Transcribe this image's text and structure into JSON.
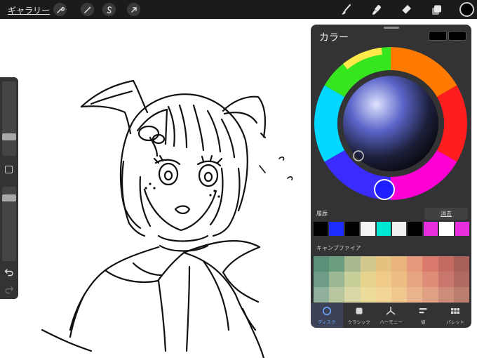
{
  "toolbar": {
    "gallery_label": "ギャラリー",
    "actions_icon": "wrench-icon",
    "adjustments_icon": "magic-wand-icon",
    "selection_icon": "s-curve-icon",
    "transform_icon": "arrow-icon",
    "tools": [
      "brush-icon",
      "smudge-icon",
      "eraser-icon",
      "layers-icon"
    ],
    "current_color": "#000000"
  },
  "color_panel": {
    "title": "カラー",
    "history_label": "履歴",
    "clear_label": "消去",
    "history_colors": [
      "#000000",
      "#1f2cff",
      "#000000",
      "#f4f6f6",
      "#00e8d4",
      "#f0f2f2",
      "#000000",
      "#e82fe0",
      "#ffffff",
      "#e82fe0"
    ],
    "palette_label": "キャンプファイア",
    "palette_colors": [
      [
        "#5b8f78",
        "#6b9e7f",
        "#a9b98e",
        "#d2c88e",
        "#e6c27f",
        "#e9b57c",
        "#e3997a",
        "#d97a6d",
        "#c56c62",
        "#a9605a"
      ],
      [
        "#6e9c86",
        "#9bb793",
        "#c9cf98",
        "#e6d48e",
        "#efcb87",
        "#eebd84",
        "#e7a681",
        "#dd8d78",
        "#c9776c",
        "#b06a62"
      ],
      [
        "#90b09b",
        "#b8c69f",
        "#d9d7a5",
        "#ecdc9c",
        "#f2d597",
        "#f0c78f",
        "#e9b38b",
        "#e0a084",
        "#cd8c7a",
        "#ba7d6f"
      ]
    ],
    "tabs": [
      {
        "label": "ディスク",
        "icon": "disc-icon",
        "active": true
      },
      {
        "label": "クラシック",
        "icon": "square-icon",
        "active": false
      },
      {
        "label": "ハーモニー",
        "icon": "harmony-icon",
        "active": false
      },
      {
        "label": "値",
        "icon": "sliders-icon",
        "active": false
      },
      {
        "label": "パレット",
        "icon": "grid-icon",
        "active": false
      }
    ]
  }
}
